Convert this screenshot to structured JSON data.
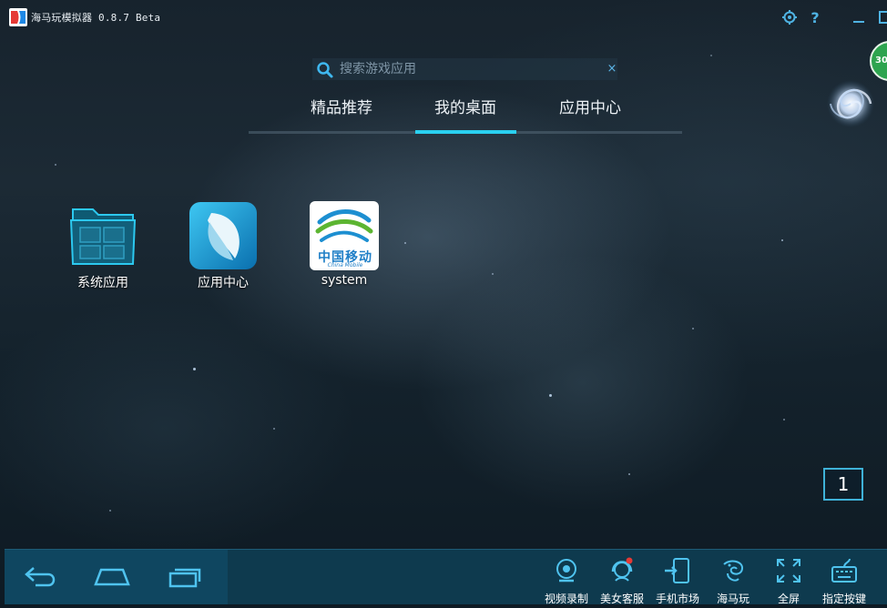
{
  "window": {
    "title": "海马玩模拟器 0.8.7 Beta"
  },
  "search": {
    "placeholder": "搜索游戏应用",
    "clear_label": "×"
  },
  "tabs": [
    {
      "label": "精品推荐",
      "active": false
    },
    {
      "label": "我的桌面",
      "active": true
    },
    {
      "label": "应用中心",
      "active": false
    }
  ],
  "desktop": {
    "icons": [
      {
        "label": "系统应用",
        "icon": "folder-icon"
      },
      {
        "label": "应用中心",
        "icon": "app-center-icon"
      },
      {
        "label": "system",
        "icon": "china-mobile-icon"
      }
    ],
    "china_mobile": {
      "cn": "中国移动",
      "en": "China Mobile"
    },
    "page_number": "1"
  },
  "badge": {
    "text": "30"
  },
  "toolbar": {
    "items": [
      {
        "label": "视频录制",
        "icon": "camera-icon"
      },
      {
        "label": "美女客服",
        "icon": "headset-icon"
      },
      {
        "label": "手机市场",
        "icon": "phone-market-icon"
      },
      {
        "label": "海马玩",
        "icon": "seahorse-icon"
      },
      {
        "label": "全屏",
        "icon": "fullscreen-icon"
      },
      {
        "label": "指定按键",
        "icon": "keyboard-icon"
      }
    ]
  },
  "colors": {
    "accent": "#2ad0f0",
    "bottom_bar": "#0e3a4e",
    "badge_green": "#2ea44f",
    "notification_red": "#e53935"
  }
}
